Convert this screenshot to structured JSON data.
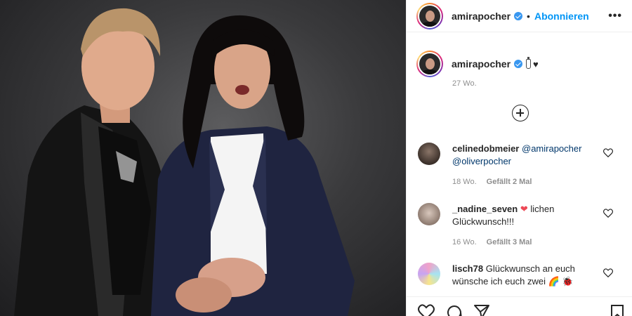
{
  "post": {
    "username": "amirapocher",
    "separator": "•",
    "follow_label": "Abonnieren",
    "more_label": "•••",
    "caption_heart": "♥",
    "time": "27 Wo."
  },
  "comments": [
    {
      "username": "celinedobmeier",
      "mention1": "@amirapocher",
      "mention2": "@oliverpocher",
      "time": "18 Wo.",
      "likes": "Gefällt 2 Mal"
    },
    {
      "username": "_nadine_seven",
      "heart": "❤",
      "text": "lichen Glückwunsch!!!",
      "time": "16 Wo.",
      "likes": "Gefällt 3 Mal"
    },
    {
      "username": "lisch78",
      "text": "Glückwunsch an euch wünsche ich euch zwei",
      "emojis": "🌈 🐞"
    }
  ],
  "icons": {
    "verified": "verified-badge-icon",
    "add_comment": "plus-circle-icon",
    "like": "heart-icon",
    "comment": "comment-bubble-icon",
    "share": "paper-plane-icon",
    "save": "bookmark-icon"
  },
  "colors": {
    "accent": "#0095f6",
    "verified": "#3897f0",
    "heart_red": "#ed4956",
    "text": "#262626",
    "meta": "#8e8e8e"
  }
}
